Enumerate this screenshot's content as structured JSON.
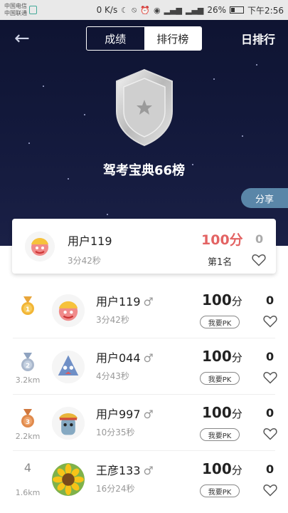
{
  "status_bar": {
    "carrier_1": "中国电信",
    "carrier_2": "中国联通",
    "network_speed": "0 K/s",
    "battery": "26%",
    "time": "下午2:56"
  },
  "nav": {
    "tab_scores": "成绩",
    "tab_ranking": "排行榜",
    "active_tab": "排行榜",
    "day_rank": "日排行"
  },
  "hero": {
    "title": "驾考宝典66榜",
    "share": "分享"
  },
  "my_card": {
    "name": "用户119",
    "time": "3分42秒",
    "score": "100分",
    "rank": "第1名",
    "likes": "0"
  },
  "list": [
    {
      "rank": "1",
      "medal": "gold",
      "distance": "",
      "name": "用户119",
      "gender": "♂",
      "time": "3分42秒",
      "score": "100",
      "unit": "分",
      "pk": "我要PK",
      "likes": "0"
    },
    {
      "rank": "2",
      "medal": "silver",
      "distance": "3.2km",
      "name": "用户044",
      "gender": "♂",
      "time": "4分43秒",
      "score": "100",
      "unit": "分",
      "pk": "我要PK",
      "likes": "0"
    },
    {
      "rank": "3",
      "medal": "bronze",
      "distance": "2.2km",
      "name": "用户997",
      "gender": "♂",
      "time": "10分35秒",
      "score": "100",
      "unit": "分",
      "pk": "我要PK",
      "likes": "0"
    },
    {
      "rank": "4",
      "medal": "",
      "distance": "1.6km",
      "name": "王彦133",
      "gender": "♂",
      "time": "16分24秒",
      "score": "100",
      "unit": "分",
      "pk": "我要PK",
      "likes": "0"
    }
  ],
  "colors": {
    "accent_score": "#e36363",
    "share_button": "#5a86a8",
    "hero_bg": "#12183a"
  }
}
